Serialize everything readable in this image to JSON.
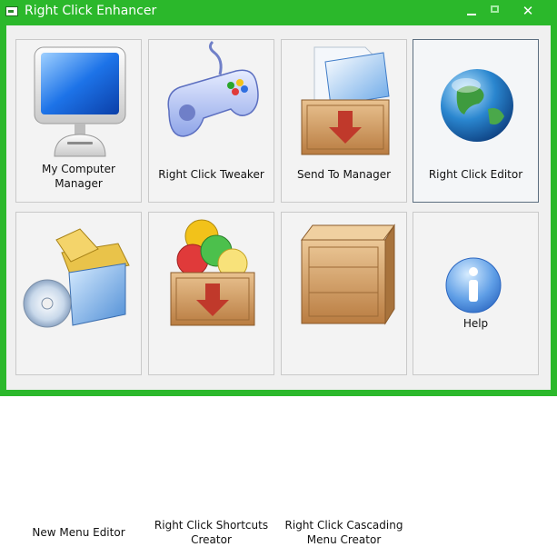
{
  "window": {
    "title": "Right Click Enhancer"
  },
  "controls": {
    "minimize": "minimize",
    "maximize": "maximize",
    "close": "✕"
  },
  "tiles": [
    {
      "line1": "My Computer",
      "line2": "Manager",
      "icon": "computer-monitor-icon"
    },
    {
      "line1": "Right Click Tweaker",
      "line2": "",
      "icon": "gamepad-icon"
    },
    {
      "line1": "Send To Manager",
      "line2": "",
      "icon": "send-to-box-icon"
    },
    {
      "line1": "Right Click Editor",
      "line2": "",
      "icon": "globe-icon"
    },
    {
      "line1": "New Menu Editor",
      "line2": "",
      "icon": "new-menu-box-icon"
    },
    {
      "line1": "Right Click Shortcuts",
      "line2": "Creator",
      "icon": "shortcuts-box-icon"
    },
    {
      "line1": "Right Click Cascading",
      "line2": "Menu Creator",
      "icon": "wooden-crate-icon"
    },
    {
      "line1": "Help",
      "line2": "",
      "icon": "info-icon"
    }
  ],
  "colors": {
    "titlebar": "#2bb82b",
    "background": "#f0f0f0",
    "tile_border": "#c9c9c9",
    "selected_border": "#5d6f80"
  }
}
